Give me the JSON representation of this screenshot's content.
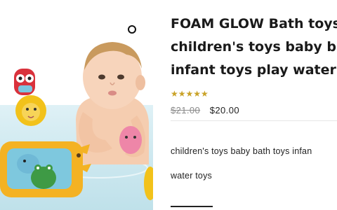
{
  "product": {
    "title_lines": [
      "FOAM GLOW Bath toys",
      "children's toys baby bat",
      "infant toys play water to"
    ],
    "rating_stars": "★★★★★",
    "rating": 5,
    "old_price": "$21.00",
    "new_price": "$20.00",
    "description_line1": "children's toys baby bath toys infan",
    "description_line2": "water toys"
  },
  "image": {
    "icon": "baby-bath-photo",
    "accent_colors": {
      "owl": "#d9323c",
      "lion": "#f2c21b",
      "boat": "#f4b223",
      "fish": "#ee86a8",
      "elephant": "#6fb9d6",
      "frog": "#3e9a45"
    }
  },
  "colors": {
    "star": "#c9a227",
    "old_price": "#8a8a8a",
    "title": "#1a1a1a"
  }
}
